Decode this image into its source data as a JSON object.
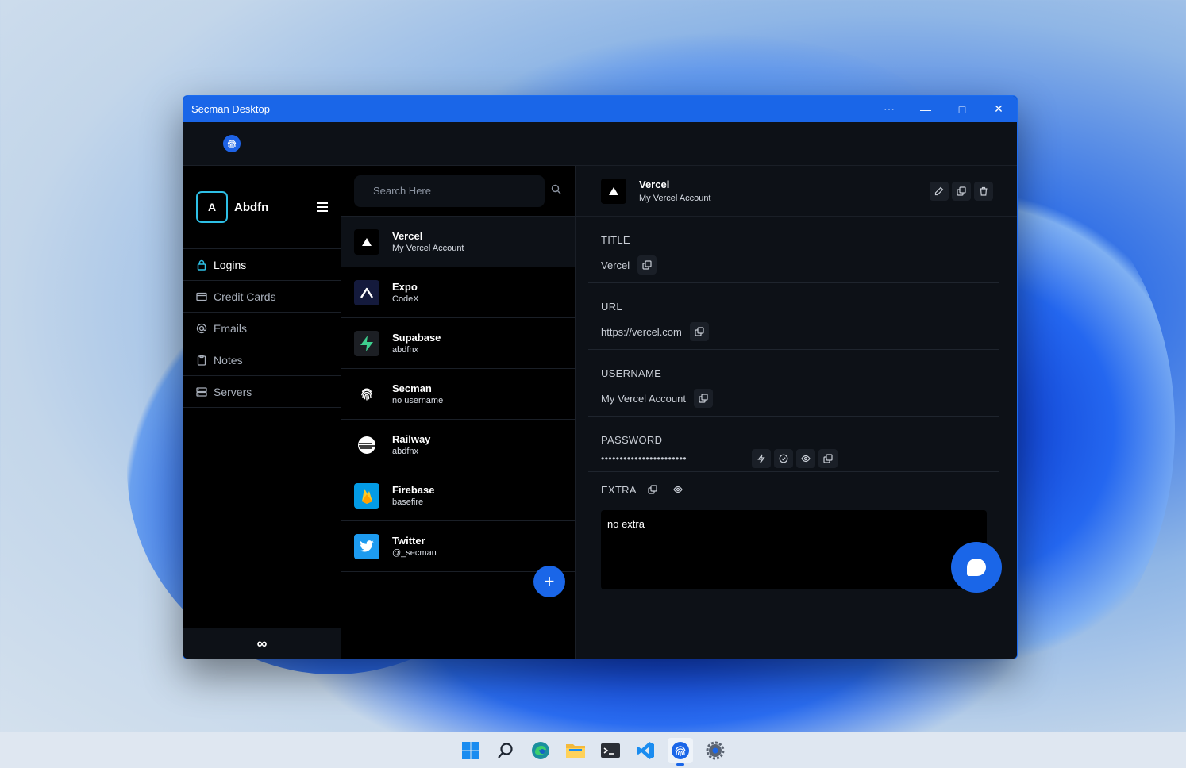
{
  "window": {
    "title": "Secman Desktop",
    "more_icon": "⋯",
    "minimize_icon": "—",
    "maximize_icon": "□",
    "close_icon": "✕"
  },
  "profile": {
    "initial": "A",
    "name": "Abdfn"
  },
  "nav": [
    {
      "label": "Logins",
      "icon": "lock-icon",
      "active": true
    },
    {
      "label": "Credit Cards",
      "icon": "credit-card-icon"
    },
    {
      "label": "Emails",
      "icon": "at-icon"
    },
    {
      "label": "Notes",
      "icon": "clipboard-icon"
    },
    {
      "label": "Servers",
      "icon": "server-icon"
    }
  ],
  "sidebar_footer": "∞",
  "search": {
    "placeholder": "Search Here"
  },
  "entries": [
    {
      "title": "Vercel",
      "subtitle": "My Vercel Account"
    },
    {
      "title": "Expo",
      "subtitle": "CodeX"
    },
    {
      "title": "Supabase",
      "subtitle": "abdfnx"
    },
    {
      "title": "Secman",
      "subtitle": "no username"
    },
    {
      "title": "Railway",
      "subtitle": "abdfnx"
    },
    {
      "title": "Firebase",
      "subtitle": "basefire"
    },
    {
      "title": "Twitter",
      "subtitle": "@_secman"
    }
  ],
  "add_label": "+",
  "detail": {
    "title": "Vercel",
    "subtitle": "My Vercel Account",
    "fields": {
      "title_label": "TITLE",
      "title_value": "Vercel",
      "url_label": "URL",
      "url_value": "https://vercel.com",
      "username_label": "USERNAME",
      "username_value": "My Vercel Account",
      "password_label": "PASSWORD",
      "password_value": "•••••••••••••••••••••••",
      "extra_label": "EXTRA",
      "extra_value": "no extra"
    }
  },
  "colors": {
    "accent": "#1a66e8",
    "avatar_border": "#2ec0e6",
    "panel": "#0d1117"
  }
}
